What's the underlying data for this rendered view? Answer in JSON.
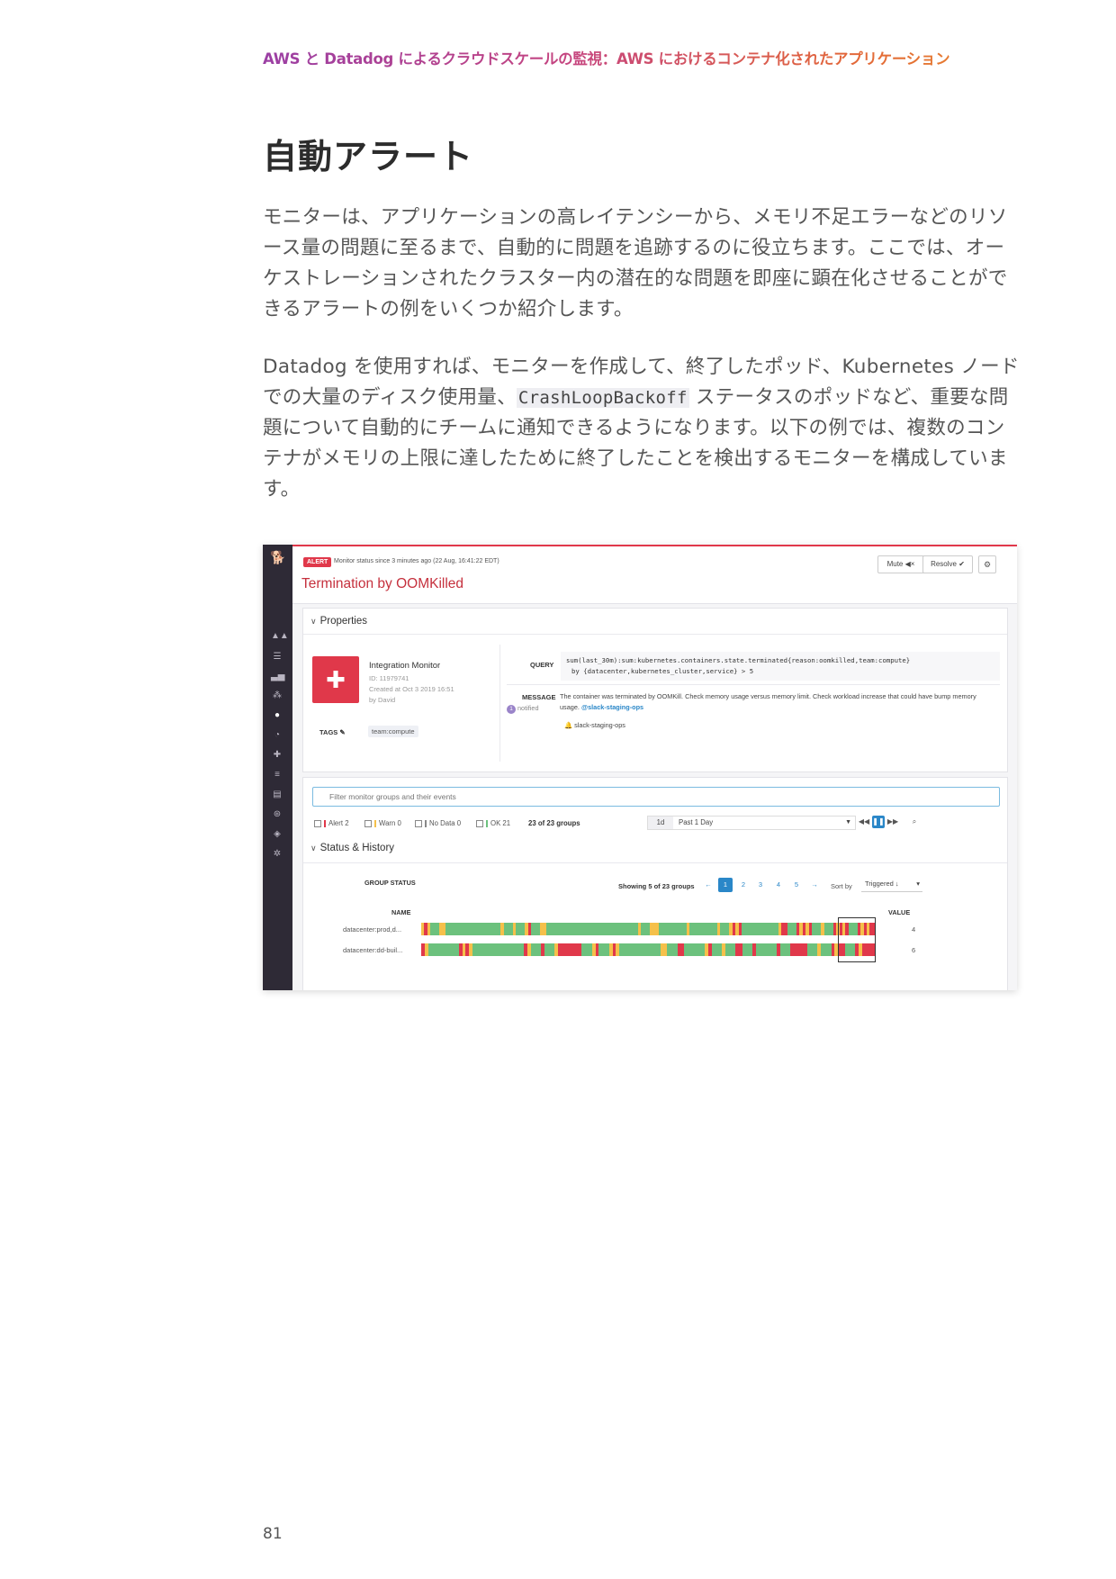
{
  "header": {
    "text": "AWS と Datadog によるクラウドスケールの監視：AWS におけるコンテナ化されたアプリケーション"
  },
  "title": "自動アラート",
  "para1": "モニターは、アプリケーションの高レイテンシーから、メモリ不足エラーなどのリソース量の問題に至るまで、自動的に問題を追跡するのに役立ちます。ここでは、オーケストレーションされたクラスター内の潜在的な問題を即座に顕在化させることができるアラートの例をいくつか紹介します。",
  "para2": {
    "before": "Datadog を使用すれば、モニターを作成して、終了したポッド、Kubernetes ノードでの大量のディスク使用量、",
    "code": "CrashLoopBackoff",
    "after": " ステータスのポッドなど、重要な問題について自動的にチームに通知できるようになります。以下の例では、複数のコンテナがメモリの上限に達したために終了したことを検出するモニターを構成しています。"
  },
  "page_number": "81",
  "screenshot": {
    "colors": {
      "alert": "#e0384a",
      "warn": "#f5c04a",
      "ok": "#6cc17d",
      "accent": "#2a87c8"
    },
    "topbar": {
      "badge": "ALERT",
      "status_line": "Monitor status since 3 minutes ago (22 Aug, 16:41:22 EDT)",
      "title": "Termination by OOMKilled",
      "mute_label": "Mute ◀×",
      "resolve_label": "Resolve ✔",
      "gear_icon": "⚙"
    },
    "sidebar_icons": [
      "binoculars-icon",
      "list-icon",
      "chart-icon",
      "graph-icon",
      "alert-icon",
      "gauge-icon",
      "puzzle-icon",
      "log-icon",
      "docs-icon",
      "apm-icon",
      "security-icon",
      "settings-icon"
    ],
    "properties": {
      "heading": "Properties",
      "integration_name": "Integration Monitor",
      "id_line": "ID: 11979741",
      "created_line": "Created at Oct 3 2019 16:51",
      "by_line": "by David",
      "tags_label": "TAGS",
      "tag": "team:compute",
      "query_label": "QUERY",
      "query_line1": "sum(last_30m):sum:kubernetes.containers.state.terminated{reason:oomkilled,team:compute}",
      "query_line2": "by {datacenter,kubernetes_cluster,service} > 5",
      "message_label": "MESSAGE",
      "notified_count": "1",
      "notified_label": "notified",
      "message_text": "The container was terminated by OOMKill. Check memory usage versus memory limit. Check workload increase that could have bump memory usage.",
      "message_link": "@slack-staging-ops",
      "notify_channel": "slack-staging-ops"
    },
    "filters": {
      "placeholder": "Filter monitor groups and their events",
      "alert": "Alert 2",
      "warn": "Warn 0",
      "nodata": "No Data 0",
      "ok": "OK 21",
      "groups_count": "23 of 23 groups",
      "range_short": "1d",
      "range_label": "Past 1 Day"
    },
    "status_history": {
      "heading": "Status & History",
      "group_status_label": "GROUP STATUS",
      "showing": "Showing 5 of 23 groups",
      "pages": [
        "1",
        "2",
        "3",
        "4",
        "5"
      ],
      "sort_label": "Sort by",
      "sort_value": "Triggered ↓",
      "name_header": "NAME",
      "value_header": "VALUE",
      "rows": [
        {
          "name": "datacenter:prod,d...",
          "value": "4"
        },
        {
          "name": "datacenter:dd-buil...",
          "value": "6"
        }
      ]
    }
  }
}
